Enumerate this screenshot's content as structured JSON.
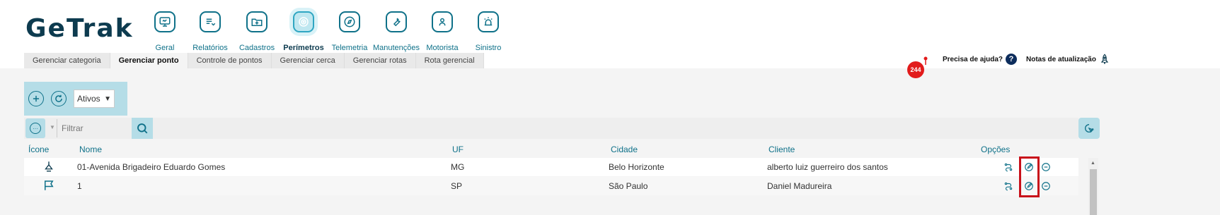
{
  "brand": {
    "logo_text": "GeTrak"
  },
  "nav": [
    {
      "label": "Geral",
      "icon": "monitor-icon",
      "active": false
    },
    {
      "label": "Relatórios",
      "icon": "report-icon",
      "active": false
    },
    {
      "label": "Cadastros",
      "icon": "folder-add-icon",
      "active": false
    },
    {
      "label": "Perímetros",
      "icon": "target-icon",
      "active": true
    },
    {
      "label": "Telemetria",
      "icon": "compass-icon",
      "active": false
    },
    {
      "label": "Manutenções",
      "icon": "wrench-icon",
      "active": false
    },
    {
      "label": "Motorista",
      "icon": "driver-icon",
      "active": false
    },
    {
      "label": "Sinistro",
      "icon": "alarm-icon",
      "active": false
    }
  ],
  "tabs": [
    {
      "label": "Gerenciar categoria",
      "active": false
    },
    {
      "label": "Gerenciar ponto",
      "active": true
    },
    {
      "label": "Controle de pontos",
      "active": false
    },
    {
      "label": "Gerenciar cerca",
      "active": false
    },
    {
      "label": "Gerenciar rotas",
      "active": false
    },
    {
      "label": "Rota gerencial",
      "active": false
    }
  ],
  "header_right": {
    "notification_count": "244",
    "help_label": "Precisa de ajuda?",
    "help_icon": "?",
    "updates_label": "Notas de atualização"
  },
  "toolbar": {
    "status_select": "Ativos"
  },
  "filter": {
    "placeholder": "Filtrar",
    "options_icon": "···"
  },
  "table": {
    "headers": {
      "icon": "Ícone",
      "name": "Nome",
      "uf": "UF",
      "city": "Cidade",
      "client": "Cliente",
      "options": "Opções"
    },
    "rows": [
      {
        "icon": "pin-icon",
        "name": "01-Avenida Brigadeiro Eduardo Gomes",
        "uf": "MG",
        "city": "Belo Horizonte",
        "client": "alberto luiz guerreiro dos santos"
      },
      {
        "icon": "flag-icon",
        "name": "1",
        "uf": "SP",
        "city": "São Paulo",
        "client": "Daniel Madureira"
      }
    ]
  },
  "colors": {
    "primary": "#0f7189",
    "accent_bg": "#b5dde7",
    "highlight": "#c8101a",
    "badge": "#e21b1b"
  }
}
